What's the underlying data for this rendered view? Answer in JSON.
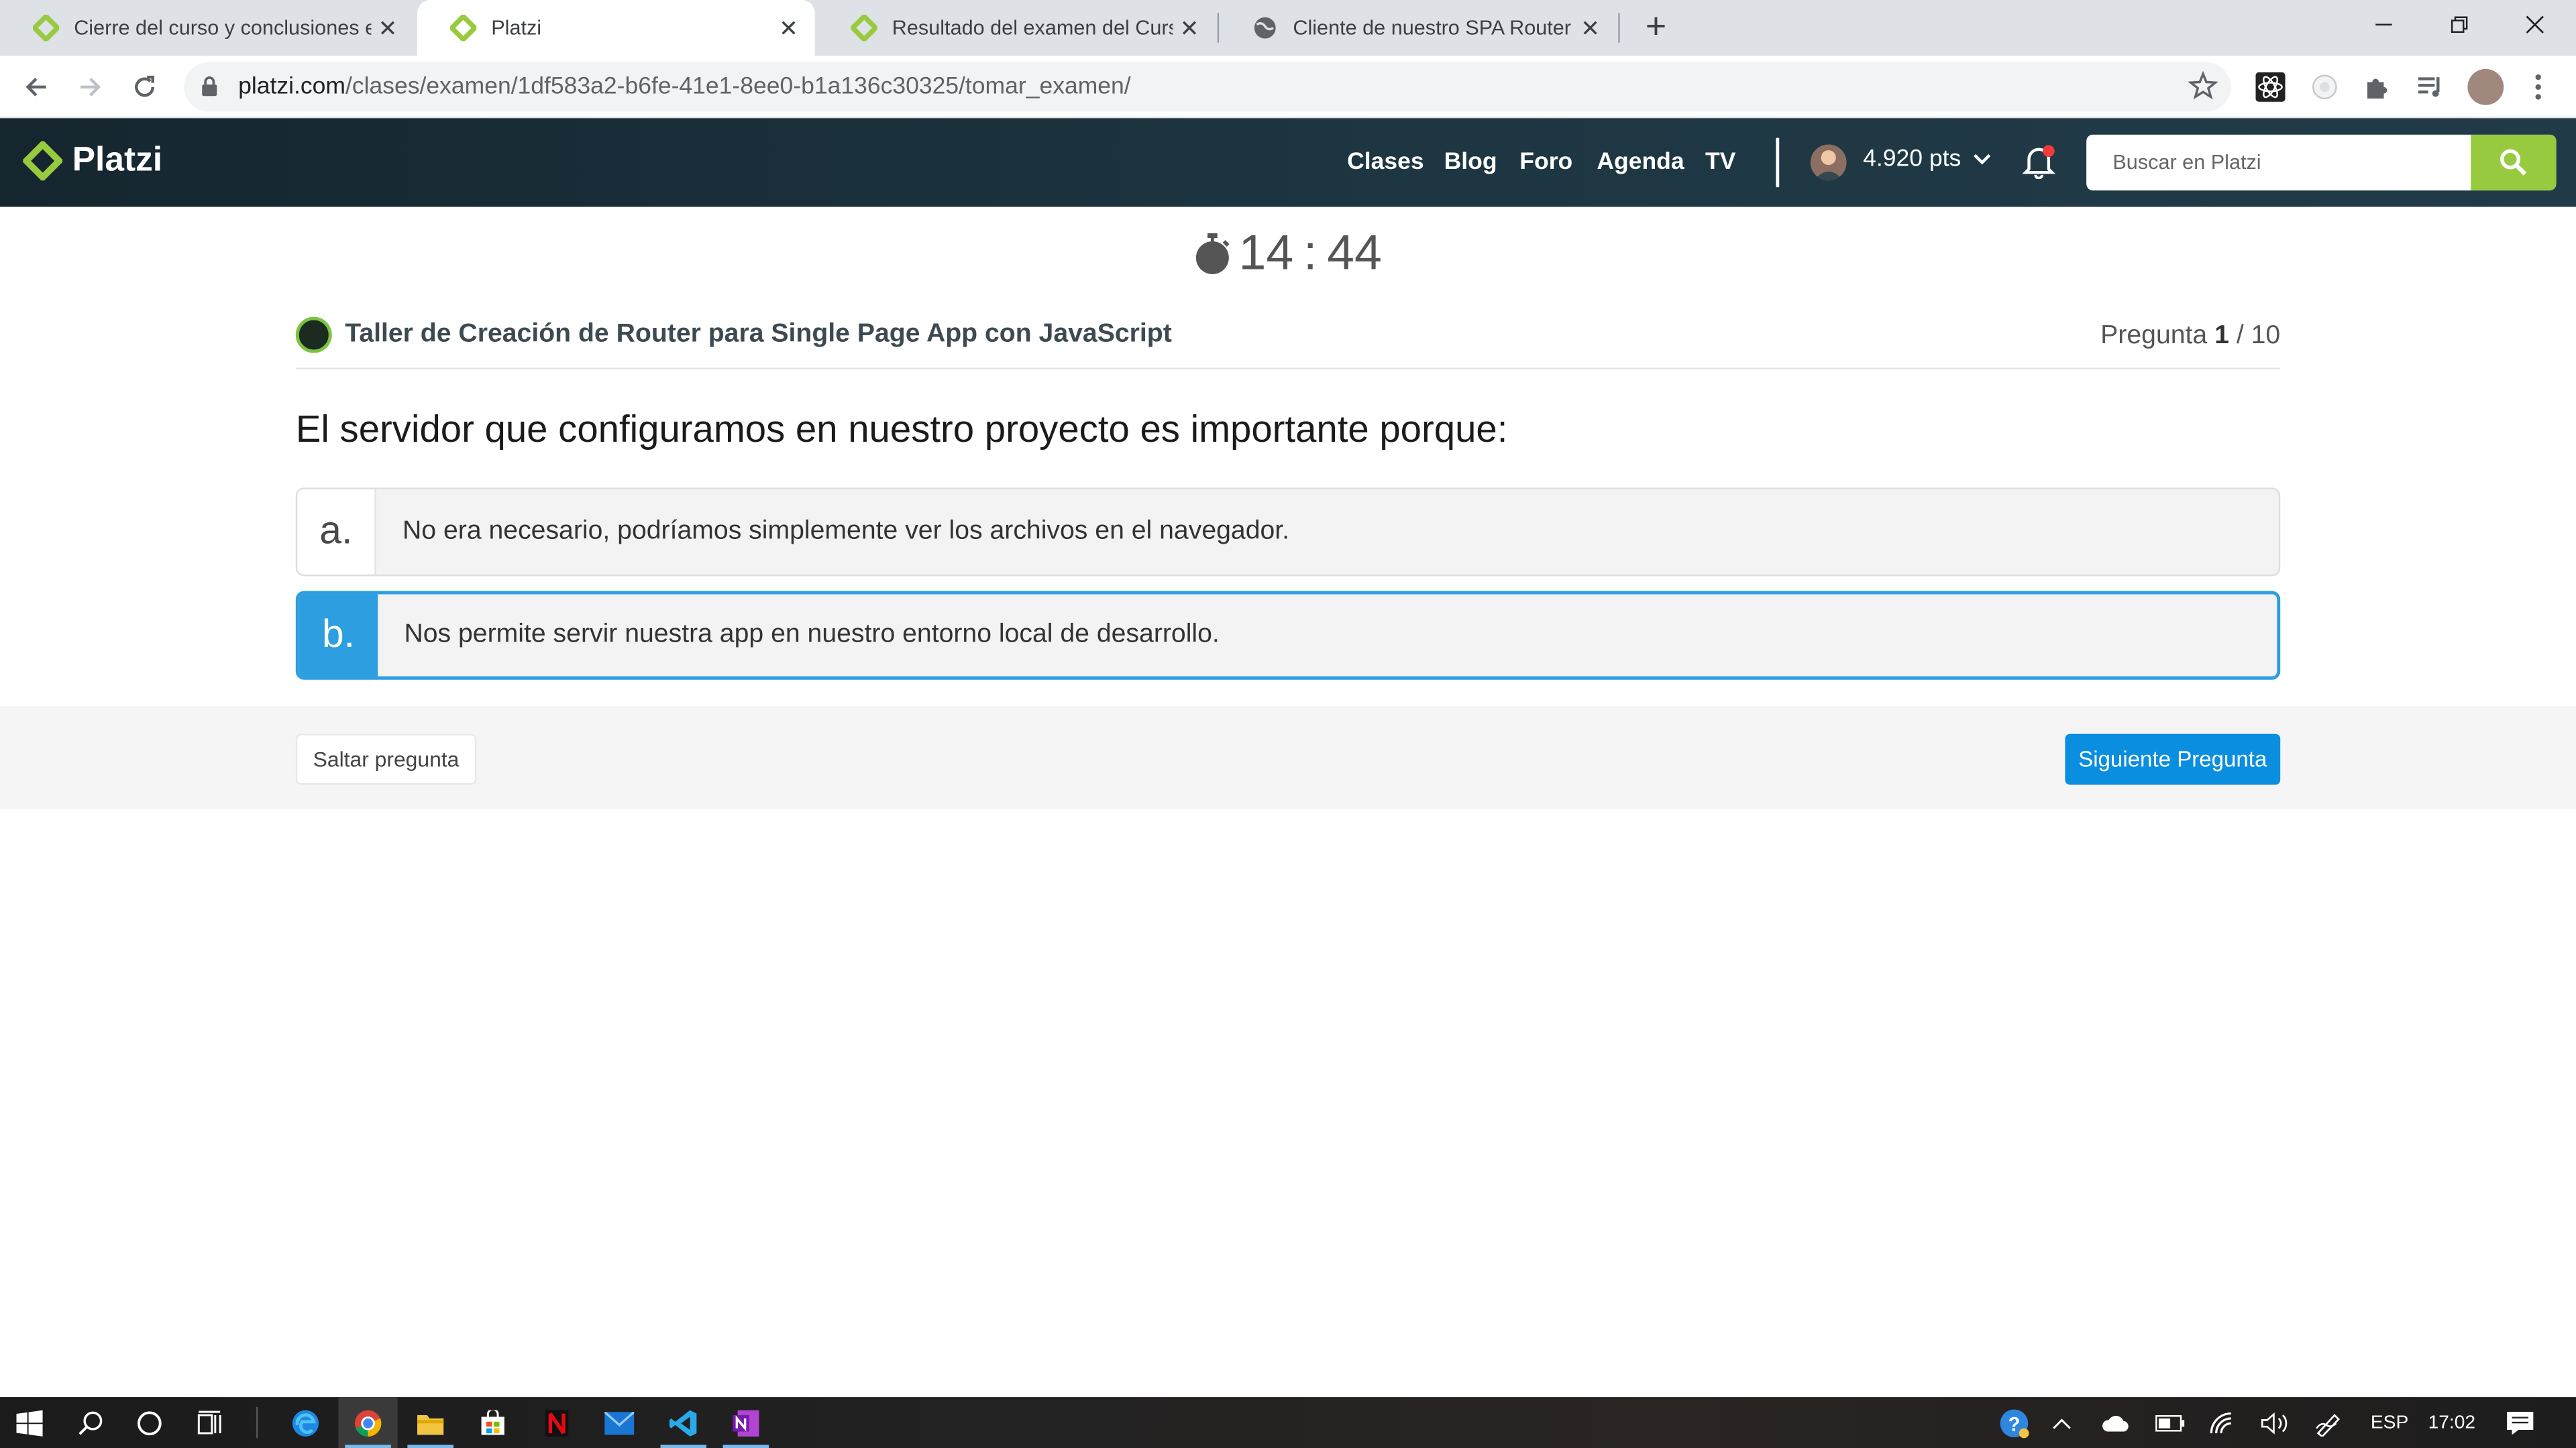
{
  "browser": {
    "tabs": [
      {
        "title": "Cierre del curso y conclusiones e",
        "active": false
      },
      {
        "title": "Platzi",
        "active": true
      },
      {
        "title": "Resultado del examen del Curso",
        "active": false
      },
      {
        "title": "Cliente de nuestro SPA Router",
        "active": false
      }
    ],
    "new_tab": "+",
    "url_host": "platzi.com",
    "url_path": "/clases/examen/1df583a2-b6fe-41e1-8ee0-b1a136c30325/tomar_examen/"
  },
  "header": {
    "logo_text": "Platzi",
    "nav": [
      "Clases",
      "Blog",
      "Foro",
      "Agenda",
      "TV"
    ],
    "points": "4.920 pts",
    "search_placeholder": "Buscar en Platzi"
  },
  "exam": {
    "timer_minutes": "14",
    "timer_sep": ":",
    "timer_seconds": "44",
    "course_name": "Taller de Creación de Router para Single Page App con JavaScript",
    "question_label": "Pregunta",
    "question_current": "1",
    "question_total": "/ 10",
    "question_text": "El servidor que configuramos en nuestro proyecto es importante porque:",
    "options": [
      {
        "letter": "a.",
        "text": "No era necesario, podríamos simplemente ver los archivos en el navegador.",
        "selected": false
      },
      {
        "letter": "b.",
        "text": "Nos permite servir nuestra app en nuestro entorno local de desarrollo.",
        "selected": true
      }
    ],
    "skip_label": "Saltar pregunta",
    "next_label": "Siguiente Pregunta"
  },
  "taskbar": {
    "language": "ESP",
    "time": "17:02"
  },
  "colors": {
    "platzi_green": "#98ca3f",
    "selected_blue": "#2d9fe0",
    "button_blue": "#0a8ee0",
    "header_dark": "#1d3642"
  }
}
